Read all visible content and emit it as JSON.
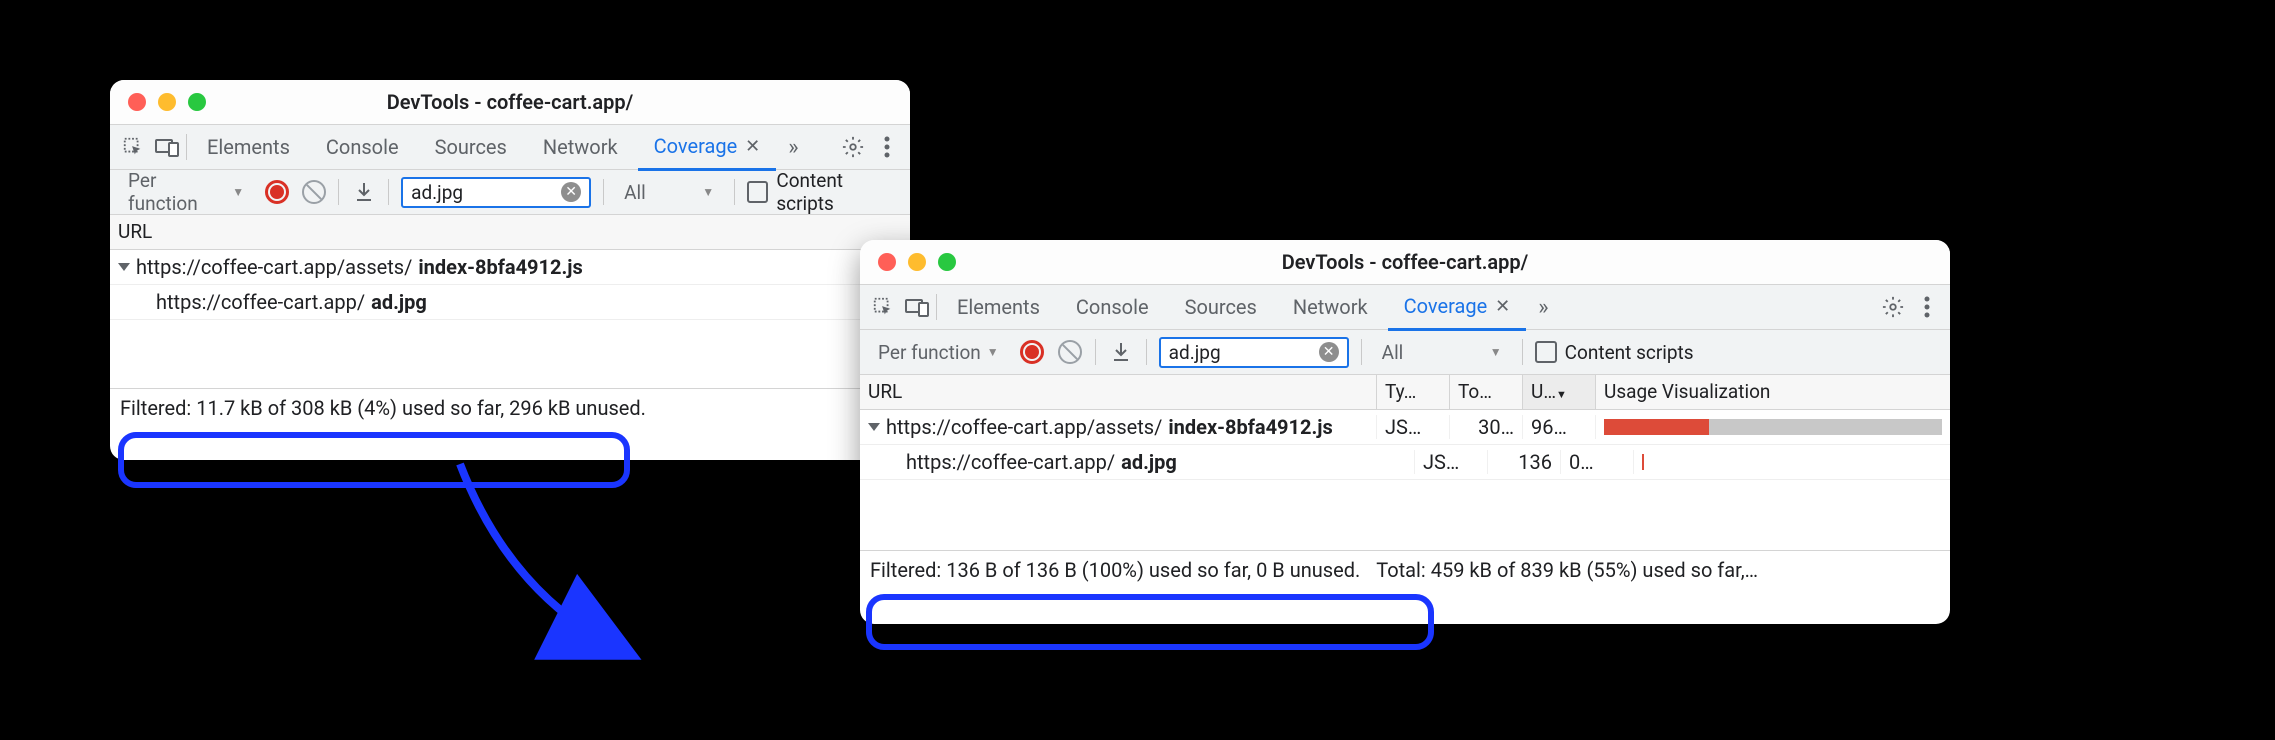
{
  "windows": {
    "left": {
      "title": "DevTools - coffee-cart.app/",
      "tabs": [
        "Elements",
        "Console",
        "Sources",
        "Network",
        "Coverage"
      ],
      "active_tab": "Coverage",
      "toolbar": {
        "granularity": "Per function",
        "filter_value": "ad.jpg",
        "type_filter": "All",
        "content_scripts_label": "Content scripts"
      },
      "columns": {
        "url": "URL"
      },
      "rows": [
        {
          "url_prefix": "https://coffee-cart.app/assets/",
          "url_bold": "index-8bfa4912.js",
          "indent": 0,
          "expandable": true
        },
        {
          "url_prefix": "https://coffee-cart.app/",
          "url_bold": "ad.jpg",
          "indent": 1,
          "expandable": false
        }
      ],
      "status": {
        "filtered": "Filtered: 11.7 kB of 308 kB (4%) used so far, 296 kB unused."
      }
    },
    "right": {
      "title": "DevTools - coffee-cart.app/",
      "tabs": [
        "Elements",
        "Console",
        "Sources",
        "Network",
        "Coverage"
      ],
      "active_tab": "Coverage",
      "toolbar": {
        "granularity": "Per function",
        "filter_value": "ad.jpg",
        "type_filter": "All",
        "content_scripts_label": "Content scripts"
      },
      "columns": {
        "url": "URL",
        "type": "Ty…",
        "total": "To…",
        "unused": "U…",
        "usage": "Usage Visualization"
      },
      "rows": [
        {
          "url_prefix": "https://coffee-cart.app/assets/",
          "url_bold": "index-8bfa4912.js",
          "indent": 0,
          "expandable": true,
          "type": "JS…",
          "total": "30…",
          "unused": "96…",
          "usage_used_pct": 31,
          "usage_unused_pct": 69
        },
        {
          "url_prefix": "https://coffee-cart.app/",
          "url_bold": "ad.jpg",
          "indent": 1,
          "expandable": false,
          "type": "JS…",
          "total": "136",
          "unused": "0…",
          "usage_used_pct": 1,
          "usage_unused_pct": 0
        }
      ],
      "status": {
        "filtered": "Filtered: 136 B of 136 B (100%) used so far, 0 B unused.",
        "total": "Total: 459 kB of 839 kB (55%) used so far,…"
      }
    }
  }
}
